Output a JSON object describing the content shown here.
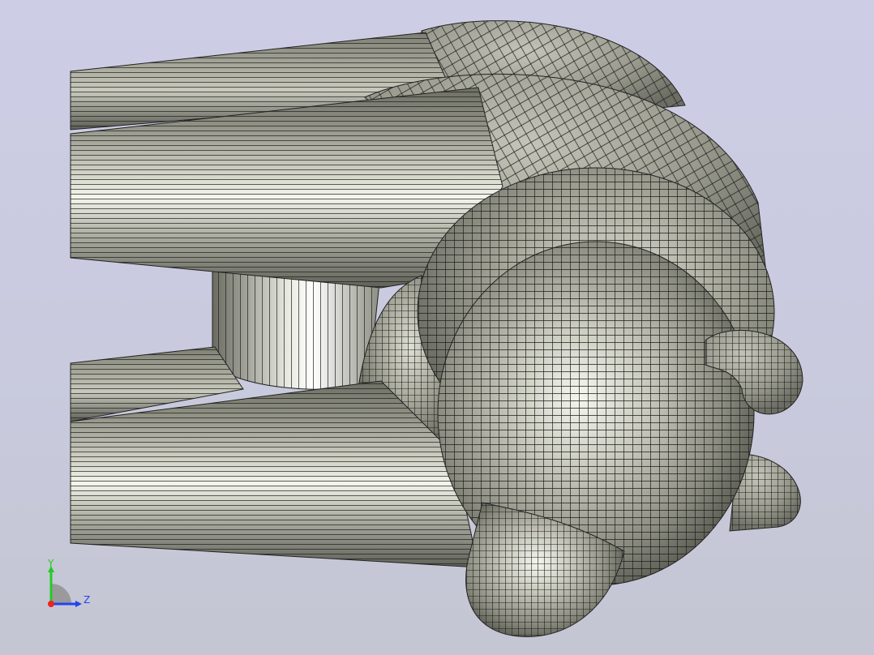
{
  "viewer": {
    "background_top": "#cdcde6",
    "background_bottom": "#c4c6d3",
    "model_surface_color": "#a9aa9c",
    "mesh_line_color": "#1c1c1c"
  },
  "axis_triad": {
    "y_label": "Y",
    "z_label": "Z",
    "y_color": "#22cc22",
    "z_color": "#2244ee",
    "x_color": "#ee2222"
  }
}
